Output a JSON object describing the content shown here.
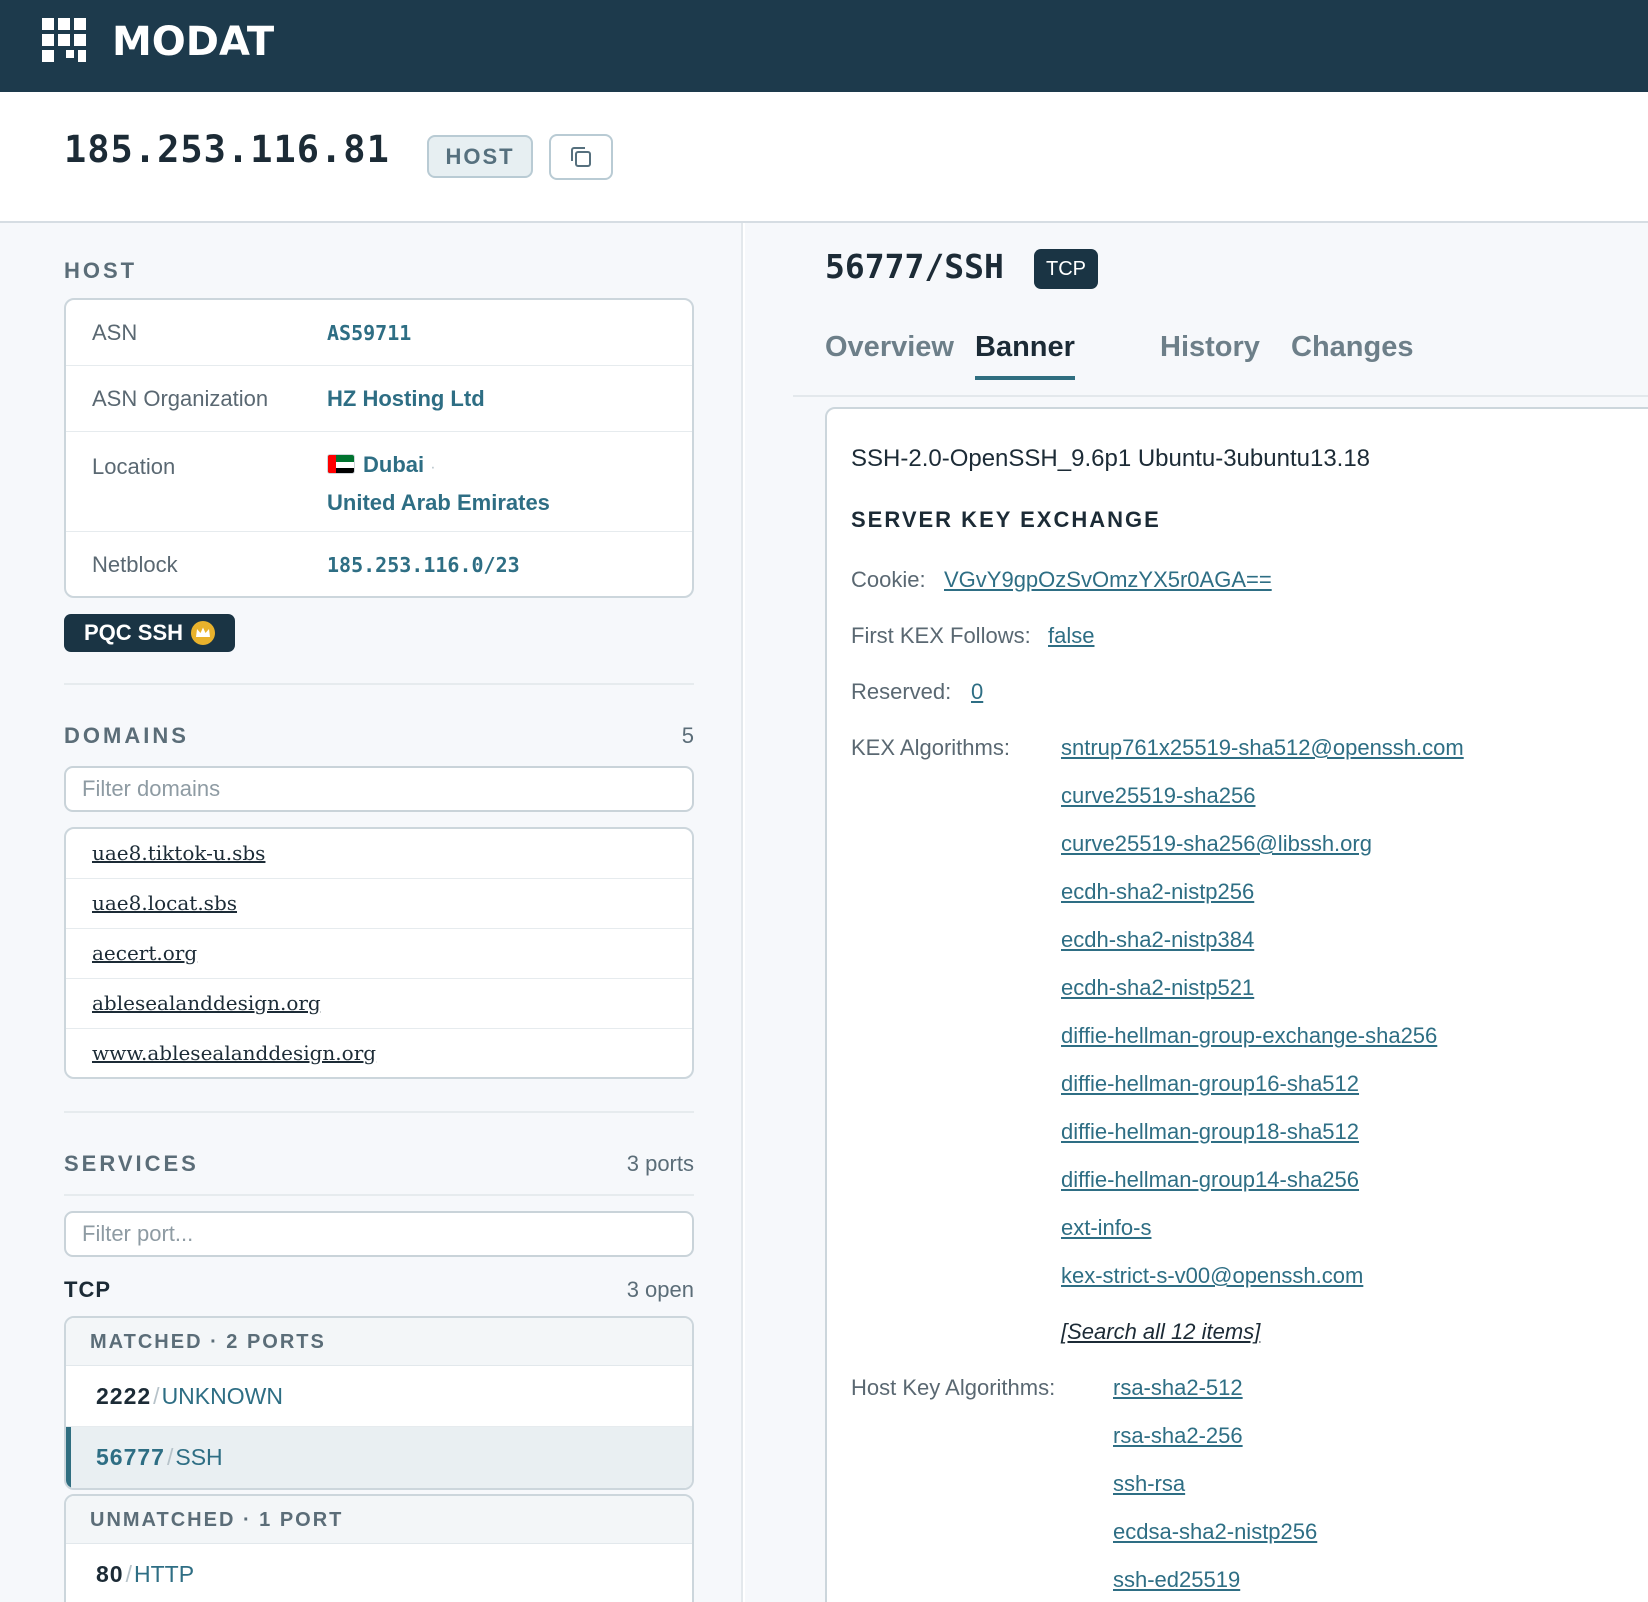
{
  "brand": {
    "name": "MODAT"
  },
  "header": {
    "ip": "185.253.116.81",
    "type_badge": "HOST",
    "copy_icon": "copy-icon"
  },
  "host": {
    "section_title": "HOST",
    "rows": [
      {
        "label": "ASN",
        "value": "AS59711"
      },
      {
        "label": "ASN Organization",
        "value": "HZ Hosting Ltd"
      },
      {
        "label": "Location",
        "city": "Dubai",
        "separator": "·",
        "country": "United Arab Emirates"
      },
      {
        "label": "Netblock",
        "value": "185.253.116.0/23"
      }
    ],
    "badge": "PQC SSH"
  },
  "domains": {
    "section_title": "DOMAINS",
    "count": "5",
    "filter_placeholder": "Filter domains",
    "items": [
      "uae8.tiktok-u.sbs",
      "uae8.locat.sbs",
      "aecert.org",
      "ablesealanddesign.org",
      "www.ablesealanddesign.org"
    ]
  },
  "services": {
    "section_title": "SERVICES",
    "count": "3 ports",
    "filter_placeholder": "Filter port...",
    "protocol": "TCP",
    "protocol_count": "3 open",
    "matched": {
      "heading": "MATCHED · 2 PORTS",
      "ports": [
        {
          "port": "2222",
          "sep": "/",
          "proto": "UNKNOWN"
        },
        {
          "port": "56777",
          "sep": "/",
          "proto": "SSH"
        }
      ]
    },
    "unmatched": {
      "heading": "UNMATCHED · 1 PORT",
      "ports": [
        {
          "port": "80",
          "sep": "/",
          "proto": "HTTP"
        }
      ]
    }
  },
  "service_detail": {
    "title": "56777/SSH",
    "transport": "TCP",
    "tabs": [
      "Overview",
      "Banner",
      "History",
      "Changes"
    ],
    "active_tab": "Banner",
    "banner": "SSH-2.0-OpenSSH_9.6p1 Ubuntu-3ubuntu13.18",
    "kex_title": "SERVER KEY EXCHANGE",
    "cookie_label": "Cookie:",
    "cookie": "VGvY9gpOzSvOmzYX5r0AGA==",
    "first_kex_label": "First KEX Follows:",
    "first_kex": "false",
    "reserved_label": "Reserved:",
    "reserved": "0",
    "kex_label": "KEX Algorithms:",
    "kex_algorithms": [
      "sntrup761x25519-sha512@openssh.com",
      "curve25519-sha256",
      "curve25519-sha256@libssh.org",
      "ecdh-sha2-nistp256",
      "ecdh-sha2-nistp384",
      "ecdh-sha2-nistp521",
      "diffie-hellman-group-exchange-sha256",
      "diffie-hellman-group16-sha512",
      "diffie-hellman-group18-sha512",
      "diffie-hellman-group14-sha256",
      "ext-info-s",
      "kex-strict-s-v00@openssh.com"
    ],
    "search_all": "[Search all 12 items]",
    "host_key_label": "Host Key Algorithms:",
    "host_key_algorithms": [
      "rsa-sha2-512",
      "rsa-sha2-256",
      "ssh-rsa",
      "ecdsa-sha2-nistp256",
      "ssh-ed25519"
    ]
  },
  "colors": {
    "topbar": "#1d3a4c",
    "accent": "#2e6e84",
    "badge_dark": "#1a3444",
    "crown": "#e9b22c"
  }
}
